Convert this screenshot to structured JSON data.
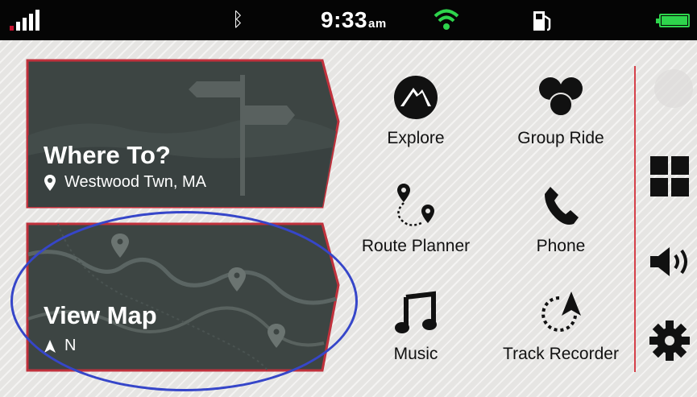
{
  "status_bar": {
    "time": "9:33",
    "time_suffix": "am",
    "icons": [
      "signal-icon",
      "bluetooth-icon",
      "wifi-icon",
      "fuel-icon",
      "battery-icon"
    ],
    "colors": {
      "wifi": "#2ed44c",
      "battery": "#2ed44c",
      "signal_low": "#c8102e"
    }
  },
  "cards": {
    "where_to": {
      "title": "Where To?",
      "location": "Westwood Twn, MA",
      "icon": "location-pin-icon"
    },
    "view_map": {
      "title": "View Map",
      "heading": "N",
      "icon": "north-arrow-icon"
    }
  },
  "apps": [
    {
      "label": "Explore",
      "icon": "explore-icon"
    },
    {
      "label": "Group Ride",
      "icon": "group-ride-icon"
    },
    {
      "label": "Route Planner",
      "icon": "route-planner-icon"
    },
    {
      "label": "Phone",
      "icon": "phone-icon"
    },
    {
      "label": "Music",
      "icon": "music-icon"
    },
    {
      "label": "Track Recorder",
      "icon": "track-recorder-icon"
    }
  ],
  "side": {
    "icons": [
      "apps-grid-icon",
      "volume-icon",
      "settings-icon"
    ]
  },
  "theme": {
    "card_bg": "#3d4543",
    "card_border": "#c0313c",
    "annotation": "#3646c9"
  }
}
